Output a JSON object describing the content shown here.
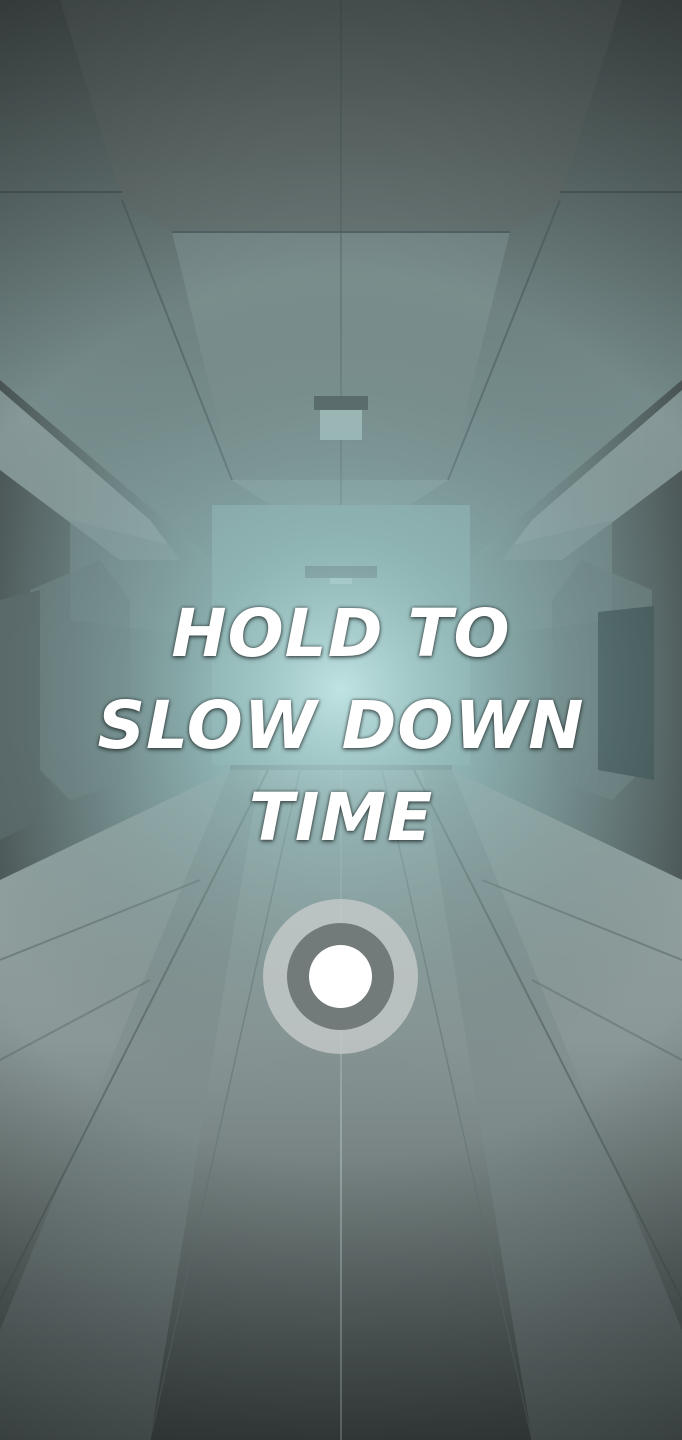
{
  "game": {
    "instruction_lines": [
      "HOLD TO",
      "SLOW DOWN",
      "TIME"
    ]
  },
  "icons": {
    "hold_target": "hold-circle-icon"
  },
  "colors": {
    "corridor_tint": "#8fb4b4",
    "glow": "#bfe5e5",
    "text": "#ffffff",
    "ring": "#c8cccc"
  }
}
